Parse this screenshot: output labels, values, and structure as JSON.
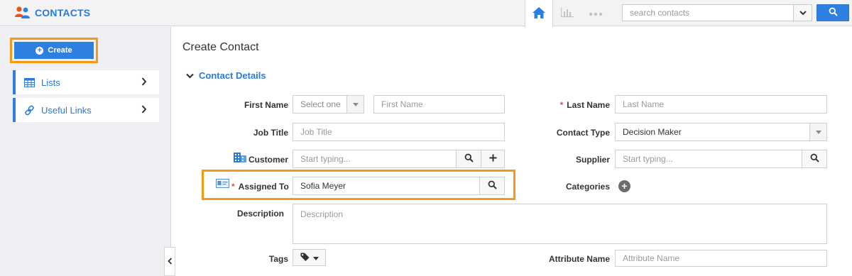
{
  "app": {
    "title": "CONTACTS",
    "brand_icon": "contacts-people-icon",
    "accent_color": "#2d7fe0",
    "highlight_color": "#f59a17"
  },
  "topbar": {
    "nav": [
      {
        "icon": "home-icon",
        "active": true
      },
      {
        "icon": "bar-chart-icon",
        "active": false
      },
      {
        "icon": "more-dots-icon",
        "active": false
      }
    ],
    "search": {
      "placeholder": "search contacts"
    }
  },
  "sidebar": {
    "create_label": "Create",
    "items": [
      {
        "label": "Lists",
        "icon": "table-icon"
      },
      {
        "label": "Useful Links",
        "icon": "link-icon"
      }
    ]
  },
  "main": {
    "page_title": "Create Contact",
    "section_title": "Contact Details",
    "fields": {
      "first_name": {
        "label": "First Name",
        "salutation": "Select one",
        "placeholder": "First Name"
      },
      "last_name": {
        "label": "Last Name",
        "placeholder": "Last Name",
        "required": true
      },
      "job_title": {
        "label": "Job Title",
        "placeholder": "Job Title"
      },
      "contact_type": {
        "label": "Contact Type",
        "value": "Decision Maker"
      },
      "customer": {
        "label": "Customer",
        "placeholder": "Start typing..."
      },
      "supplier": {
        "label": "Supplier",
        "placeholder": "Start typing..."
      },
      "assigned_to": {
        "label": "Assigned To",
        "value": "Sofia Meyer",
        "required": true
      },
      "categories": {
        "label": "Categories"
      },
      "description": {
        "label": "Description",
        "placeholder": "Description"
      },
      "tags": {
        "label": "Tags"
      },
      "attribute_name": {
        "label": "Attribute Name",
        "placeholder": "Attribute Name"
      }
    }
  }
}
